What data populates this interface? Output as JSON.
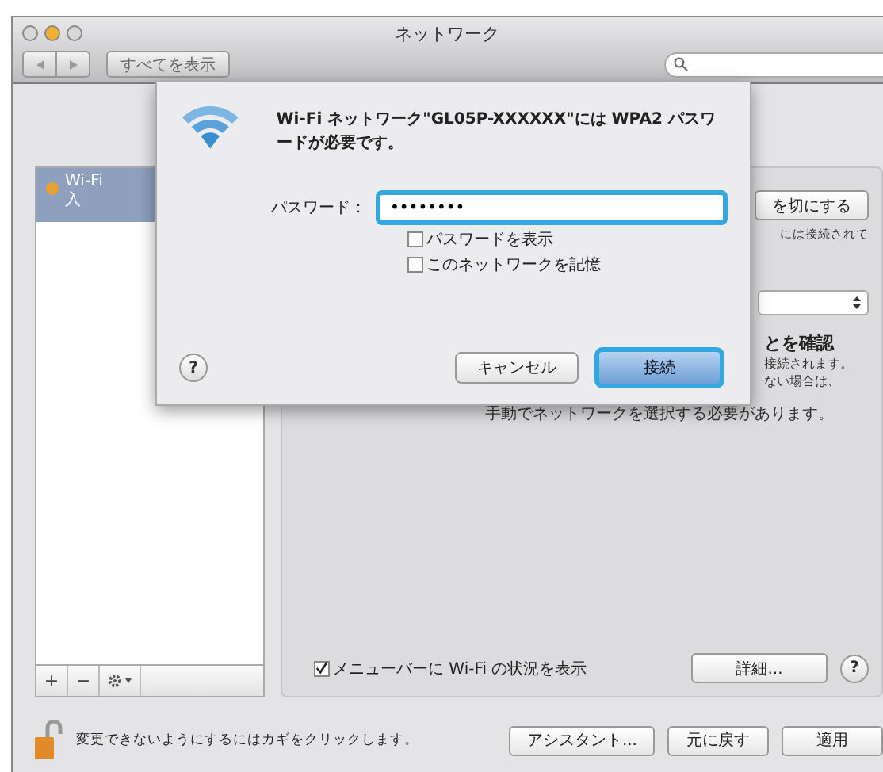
{
  "window": {
    "title": "ネットワーク"
  },
  "toolbar": {
    "show_all": "すべてを表示"
  },
  "sidebar": {
    "items": [
      {
        "name": "Wi-Fi",
        "status": "入",
        "selected": true,
        "color": "#e8a030"
      }
    ],
    "buttons": [
      "+",
      "−"
    ]
  },
  "pane": {
    "toggle_button": "を切にする",
    "status_note": "には接続されて",
    "confirm_heading": "とを確認",
    "confirm_lines": [
      "接続されます。",
      "ない場合は、",
      "手動でネットワークを選択する必要があります。"
    ],
    "show_in_menu_bar": {
      "label": "メニューバーに Wi-Fi の状況を表示",
      "checked": true
    },
    "advanced_button": "詳細...",
    "help": "?"
  },
  "footer": {
    "lock_text": "変更できないようにするにはカギをクリックします。",
    "buttons": [
      "アシスタント...",
      "元に戻す",
      "適用"
    ]
  },
  "sheet": {
    "message": "Wi-Fi ネットワーク\"GL05P-XXXXXX\"には WPA2 パスワードが必要です。",
    "password_label": "パスワード：",
    "password_value": "••••••••",
    "options": [
      {
        "label": "パスワードを表示",
        "checked": false
      },
      {
        "label": "このネットワークを記憶",
        "checked": false
      }
    ],
    "help": "?",
    "cancel": "キャンセル",
    "connect": "接続"
  }
}
